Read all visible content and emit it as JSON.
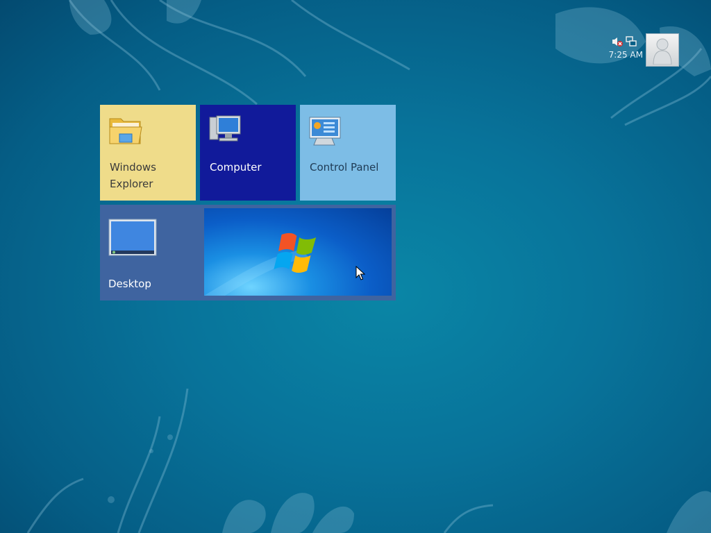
{
  "system_tray": {
    "mute_icon": "speaker-muted-icon",
    "network_icon": "network-icon",
    "clock": "7:25 AM",
    "avatar_icon": "user-avatar-icon"
  },
  "tiles": [
    {
      "id": "explorer",
      "label": "Windows Explorer",
      "icon": "folder-icon",
      "color": "#efdc8a"
    },
    {
      "id": "computer",
      "label": "Computer",
      "icon": "computer-icon",
      "color": "#111a9a"
    },
    {
      "id": "control",
      "label": "Control Panel",
      "icon": "control-panel-icon",
      "color": "#7dbde6"
    },
    {
      "id": "desktop",
      "label": "Desktop",
      "icon": "desktop-monitor-icon",
      "color": "#3f64a0"
    }
  ],
  "colors": {
    "background": "#08739a",
    "clock_text": "#e8f3fa"
  }
}
